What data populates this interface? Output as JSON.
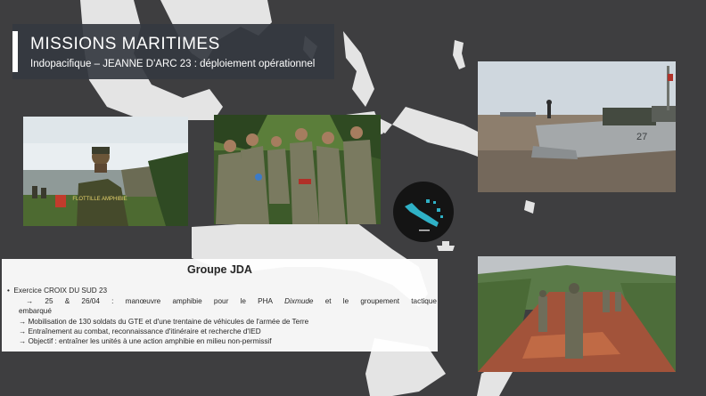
{
  "header": {
    "title": "MISSIONS MARITIMES",
    "subtitle": "Indopacifique – JEANNE D'ARC 23 : déploiement opérationnel"
  },
  "photos": {
    "soldier_back_shirt": "FLOTTILLE AMPHIBIE",
    "barge_hull_number": "27"
  },
  "group": {
    "title": "Groupe JDA",
    "exercise": "Exercice CROIX DU SUD 23",
    "line1_words": [
      "→",
      "25",
      "&",
      "26/04",
      ":",
      "manœuvre",
      "amphibie",
      "pour",
      "le",
      "PHA",
      "Dixmude",
      "et",
      "le",
      "groupement",
      "tactique"
    ],
    "line1_cont": "embarqué",
    "line2": "→ Mobilisation de 130 soldats du GTE et d'une trentaine de véhicules de l'armée de Terre",
    "line3": "→ Entraînement au combat, reconnaissance d'itinéraire et recherche d'IED",
    "line4": "→ Objectif : entraîner les unités à une action amphibie en milieu non-permissif"
  },
  "colors": {
    "background": "#3e3e40",
    "land": "#e6e6e6",
    "title_box": "#343840",
    "logo_bg": "#141414",
    "logo_accent": "#2fb1c6"
  }
}
